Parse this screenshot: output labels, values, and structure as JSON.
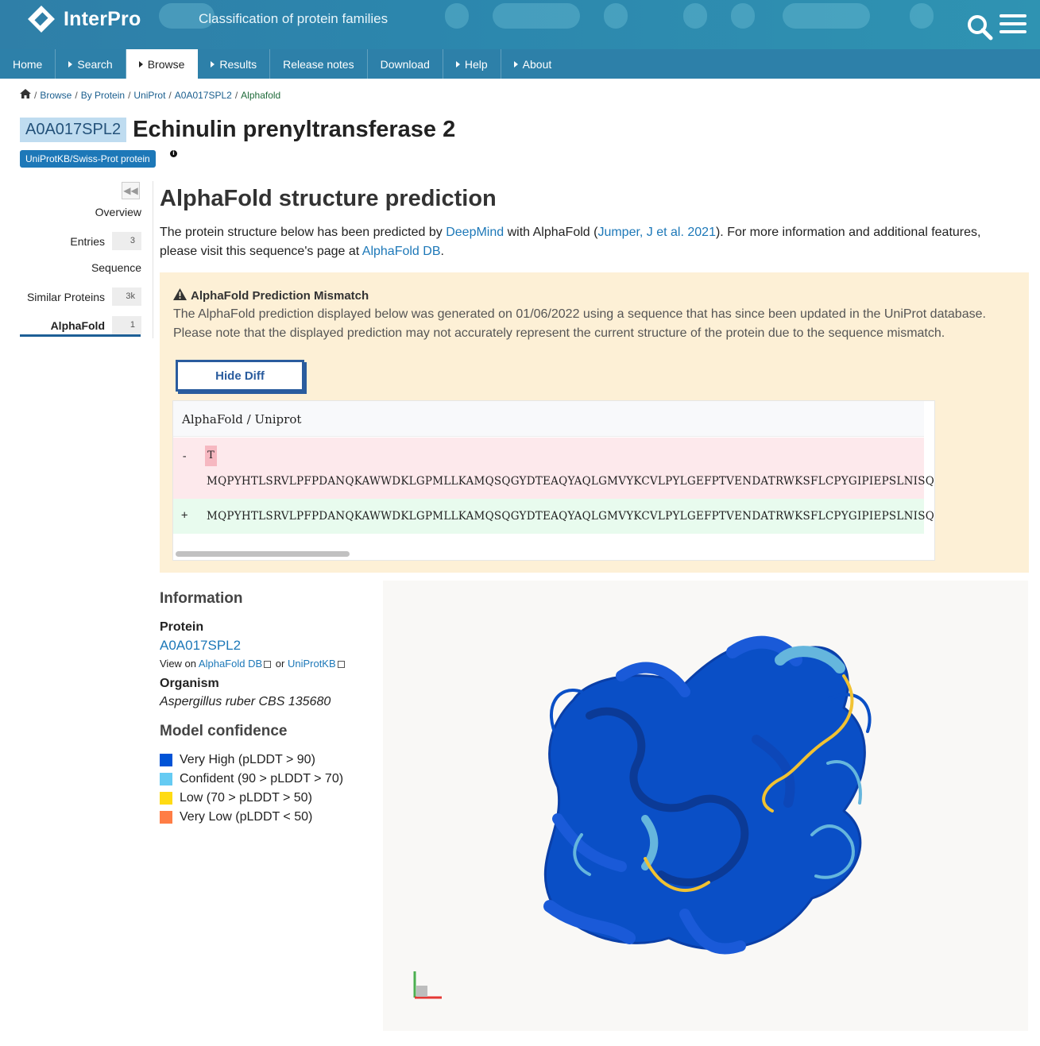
{
  "header": {
    "logo_text": "InterPro",
    "tagline": "Classification of protein families"
  },
  "nav": [
    {
      "label": "Home",
      "caret": false,
      "active": false
    },
    {
      "label": "Search",
      "caret": true,
      "active": false
    },
    {
      "label": "Browse",
      "caret": true,
      "active": true
    },
    {
      "label": "Results",
      "caret": true,
      "active": false
    },
    {
      "label": "Release notes",
      "caret": false,
      "active": false
    },
    {
      "label": "Download",
      "caret": false,
      "active": false
    },
    {
      "label": "Help",
      "caret": true,
      "active": false
    },
    {
      "label": "About",
      "caret": true,
      "active": false
    }
  ],
  "breadcrumb": {
    "items": [
      "Browse",
      "By Protein",
      "UniProt",
      "A0A017SPL2"
    ],
    "current": "Alphafold"
  },
  "protein": {
    "accession": "A0A017SPL2",
    "name": "Echinulin prenyltransferase 2",
    "db_badge": "UniProtKB/Swiss-Prot protein"
  },
  "sidemenu": [
    {
      "label": "Overview",
      "count": null,
      "active": false
    },
    {
      "label": "Entries",
      "count": "3",
      "active": false
    },
    {
      "label": "Sequence",
      "count": null,
      "active": false
    },
    {
      "label": "Similar Proteins",
      "count": "3k",
      "active": false
    },
    {
      "label": "AlphaFold",
      "count": "1",
      "active": true
    }
  ],
  "main": {
    "heading": "AlphaFold structure prediction",
    "intro_1": "The protein structure below has been predicted by ",
    "deepmind_link": "DeepMind",
    "intro_2": " with AlphaFold (",
    "citation_link": "Jumper, J et al. 2021",
    "intro_3": "). For more information and additional features, please visit this sequence's page at ",
    "afdb_link": "AlphaFold DB",
    "intro_4": "."
  },
  "mismatch": {
    "title": "AlphaFold Prediction Mismatch",
    "text": "The AlphaFold prediction displayed below was generated on 01/06/2022 using a sequence that has since been updated in the UniProt database. Please note that the displayed prediction may not accurately represent the current structure of the protein due to the sequence mismatch.",
    "button": "Hide Diff",
    "diff_header": "AlphaFold / Uniprot",
    "del_marker": "-",
    "del_char": "T",
    "del_seq": "MQPYHTLSRVLPFPDANQKAWWDKLGPMLLKAMQSQGYDTEAQYAQLGMVYKCVLPYLGEFPTVENDATRWKSFLCPYGIPIEPSLNISQGILR",
    "add_marker": "+",
    "add_seq": "MQPYHTLSRVLPFPDANQKAWWDKLGPMLLKAMQSQGYDTEAQYAQLGMVYKCVLPYLGEFPTVENDATRWKSFLCPYGIPIEPSLNISQGILR"
  },
  "information": {
    "heading": "Information",
    "protein_label": "Protein",
    "protein_link": "A0A017SPL2",
    "view_on": "View on",
    "afdb_link": "AlphaFold DB",
    "or": "or",
    "uniprot_link": "UniProtKB",
    "organism_label": "Organism",
    "organism": "Aspergillus ruber CBS 135680"
  },
  "confidence": {
    "heading": "Model confidence",
    "items": [
      {
        "label": "Very High (pLDDT > 90)",
        "color": "#0053d6"
      },
      {
        "label": "Confident (90 > pLDDT > 70)",
        "color": "#65cbf3"
      },
      {
        "label": "Low (70 > pLDDT > 50)",
        "color": "#ffdb13"
      },
      {
        "label": "Very Low (pLDDT < 50)",
        "color": "#ff7d45"
      }
    ]
  },
  "colors": {
    "header": "#2d80a9",
    "link": "#1d78b8",
    "callout_bg": "#fdf0d6",
    "button": "#2a5c9e"
  }
}
